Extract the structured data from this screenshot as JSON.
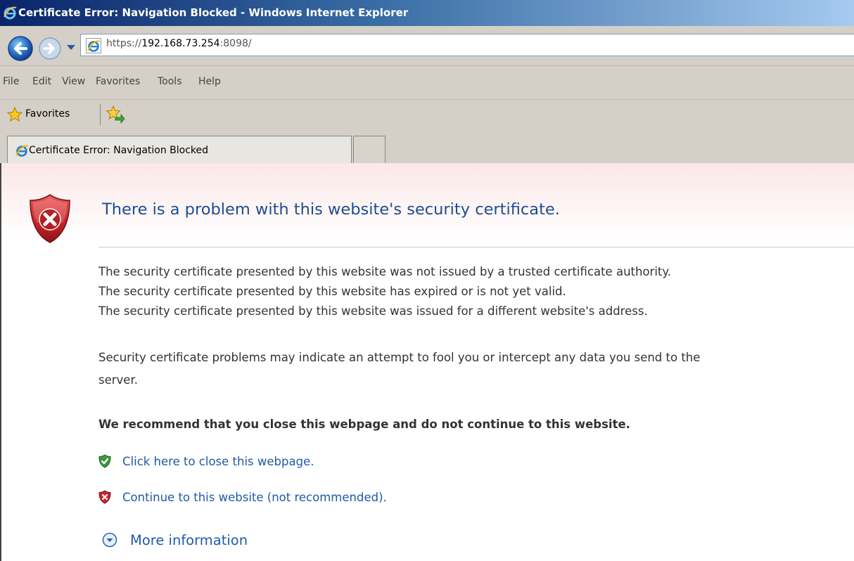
{
  "window": {
    "title": "Certificate Error: Navigation Blocked - Windows Internet Explorer"
  },
  "address_bar": {
    "scheme": "https://",
    "host": "192.168.73.254",
    "port_path": ":8098/"
  },
  "menu": {
    "items": [
      "File",
      "Edit",
      "View",
      "Favorites",
      "Tools",
      "Help"
    ]
  },
  "favorites_bar": {
    "label": "Favorites"
  },
  "tab": {
    "label": "Certificate Error: Navigation Blocked"
  },
  "page": {
    "heading": "There is a problem with this website's security certificate.",
    "reasons": [
      "The security certificate presented by this website was not issued by a trusted certificate authority.",
      "The security certificate presented by this website has expired or is not yet valid.",
      "The security certificate presented by this website was issued for a different website's address."
    ],
    "warning_line1": "Security certificate problems may indicate an attempt to fool you or intercept any data you send to the",
    "warning_line2": "server.",
    "recommendation": "We recommend that you close this webpage and do not continue to this website.",
    "close_link": "Click here to close this webpage.",
    "continue_link": "Continue to this website (not recommended).",
    "more_info": "More information"
  },
  "colors": {
    "link": "#1f5aa8",
    "heading": "#1f4e8f",
    "shield_red": "#c8262b",
    "shield_green": "#3a9a3a"
  }
}
